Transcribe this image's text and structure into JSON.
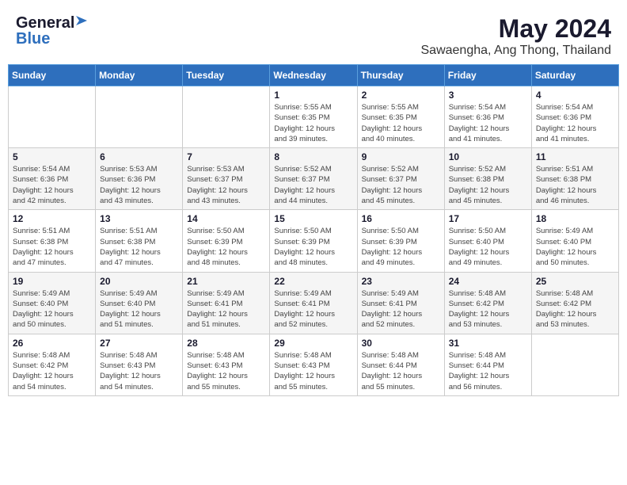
{
  "header": {
    "logo_general": "General",
    "logo_blue": "Blue",
    "title": "May 2024",
    "subtitle": "Sawaengha, Ang Thong, Thailand"
  },
  "weekdays": [
    "Sunday",
    "Monday",
    "Tuesday",
    "Wednesday",
    "Thursday",
    "Friday",
    "Saturday"
  ],
  "weeks": [
    [
      {
        "day": "",
        "info": ""
      },
      {
        "day": "",
        "info": ""
      },
      {
        "day": "",
        "info": ""
      },
      {
        "day": "1",
        "info": "Sunrise: 5:55 AM\nSunset: 6:35 PM\nDaylight: 12 hours\nand 39 minutes."
      },
      {
        "day": "2",
        "info": "Sunrise: 5:55 AM\nSunset: 6:35 PM\nDaylight: 12 hours\nand 40 minutes."
      },
      {
        "day": "3",
        "info": "Sunrise: 5:54 AM\nSunset: 6:36 PM\nDaylight: 12 hours\nand 41 minutes."
      },
      {
        "day": "4",
        "info": "Sunrise: 5:54 AM\nSunset: 6:36 PM\nDaylight: 12 hours\nand 41 minutes."
      }
    ],
    [
      {
        "day": "5",
        "info": "Sunrise: 5:54 AM\nSunset: 6:36 PM\nDaylight: 12 hours\nand 42 minutes."
      },
      {
        "day": "6",
        "info": "Sunrise: 5:53 AM\nSunset: 6:36 PM\nDaylight: 12 hours\nand 43 minutes."
      },
      {
        "day": "7",
        "info": "Sunrise: 5:53 AM\nSunset: 6:37 PM\nDaylight: 12 hours\nand 43 minutes."
      },
      {
        "day": "8",
        "info": "Sunrise: 5:52 AM\nSunset: 6:37 PM\nDaylight: 12 hours\nand 44 minutes."
      },
      {
        "day": "9",
        "info": "Sunrise: 5:52 AM\nSunset: 6:37 PM\nDaylight: 12 hours\nand 45 minutes."
      },
      {
        "day": "10",
        "info": "Sunrise: 5:52 AM\nSunset: 6:38 PM\nDaylight: 12 hours\nand 45 minutes."
      },
      {
        "day": "11",
        "info": "Sunrise: 5:51 AM\nSunset: 6:38 PM\nDaylight: 12 hours\nand 46 minutes."
      }
    ],
    [
      {
        "day": "12",
        "info": "Sunrise: 5:51 AM\nSunset: 6:38 PM\nDaylight: 12 hours\nand 47 minutes."
      },
      {
        "day": "13",
        "info": "Sunrise: 5:51 AM\nSunset: 6:38 PM\nDaylight: 12 hours\nand 47 minutes."
      },
      {
        "day": "14",
        "info": "Sunrise: 5:50 AM\nSunset: 6:39 PM\nDaylight: 12 hours\nand 48 minutes."
      },
      {
        "day": "15",
        "info": "Sunrise: 5:50 AM\nSunset: 6:39 PM\nDaylight: 12 hours\nand 48 minutes."
      },
      {
        "day": "16",
        "info": "Sunrise: 5:50 AM\nSunset: 6:39 PM\nDaylight: 12 hours\nand 49 minutes."
      },
      {
        "day": "17",
        "info": "Sunrise: 5:50 AM\nSunset: 6:40 PM\nDaylight: 12 hours\nand 49 minutes."
      },
      {
        "day": "18",
        "info": "Sunrise: 5:49 AM\nSunset: 6:40 PM\nDaylight: 12 hours\nand 50 minutes."
      }
    ],
    [
      {
        "day": "19",
        "info": "Sunrise: 5:49 AM\nSunset: 6:40 PM\nDaylight: 12 hours\nand 50 minutes."
      },
      {
        "day": "20",
        "info": "Sunrise: 5:49 AM\nSunset: 6:40 PM\nDaylight: 12 hours\nand 51 minutes."
      },
      {
        "day": "21",
        "info": "Sunrise: 5:49 AM\nSunset: 6:41 PM\nDaylight: 12 hours\nand 51 minutes."
      },
      {
        "day": "22",
        "info": "Sunrise: 5:49 AM\nSunset: 6:41 PM\nDaylight: 12 hours\nand 52 minutes."
      },
      {
        "day": "23",
        "info": "Sunrise: 5:49 AM\nSunset: 6:41 PM\nDaylight: 12 hours\nand 52 minutes."
      },
      {
        "day": "24",
        "info": "Sunrise: 5:48 AM\nSunset: 6:42 PM\nDaylight: 12 hours\nand 53 minutes."
      },
      {
        "day": "25",
        "info": "Sunrise: 5:48 AM\nSunset: 6:42 PM\nDaylight: 12 hours\nand 53 minutes."
      }
    ],
    [
      {
        "day": "26",
        "info": "Sunrise: 5:48 AM\nSunset: 6:42 PM\nDaylight: 12 hours\nand 54 minutes."
      },
      {
        "day": "27",
        "info": "Sunrise: 5:48 AM\nSunset: 6:43 PM\nDaylight: 12 hours\nand 54 minutes."
      },
      {
        "day": "28",
        "info": "Sunrise: 5:48 AM\nSunset: 6:43 PM\nDaylight: 12 hours\nand 55 minutes."
      },
      {
        "day": "29",
        "info": "Sunrise: 5:48 AM\nSunset: 6:43 PM\nDaylight: 12 hours\nand 55 minutes."
      },
      {
        "day": "30",
        "info": "Sunrise: 5:48 AM\nSunset: 6:44 PM\nDaylight: 12 hours\nand 55 minutes."
      },
      {
        "day": "31",
        "info": "Sunrise: 5:48 AM\nSunset: 6:44 PM\nDaylight: 12 hours\nand 56 minutes."
      },
      {
        "day": "",
        "info": ""
      }
    ]
  ]
}
